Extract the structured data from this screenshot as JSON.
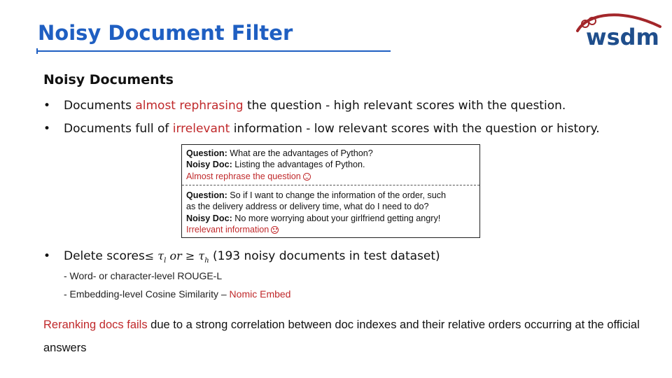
{
  "title": "Noisy Document Filter",
  "logo": {
    "text": "wsdm",
    "accent_color": "#a3262a",
    "text_color": "#1f4e8c"
  },
  "section_heading": "Noisy Documents",
  "bullets": [
    {
      "pre": "Documents ",
      "highlight": "almost rephrasing",
      "post": " the question - high relevant scores with the question."
    },
    {
      "pre": "Documents full of ",
      "highlight": "irrelevant",
      "post": " information - low relevant scores with the question or history."
    }
  ],
  "bullet_marker": "•",
  "figure": {
    "example1": {
      "question_label": "Question:",
      "question_text": " What are the advantages of Python?",
      "doc_label": "Noisy Doc:",
      "doc_text": " Listing the advantages of Python.",
      "note": "Almost rephrase the question"
    },
    "example2": {
      "question_label": "Question:",
      "question_text": " So if I want to change the information of the order, such",
      "question_text2": "as the delivery address or delivery time, what do I need to do?",
      "doc_label": "Noisy Doc:",
      "doc_text": " No more worrying about your girlfriend getting angry!",
      "note": "Irrelevant information"
    }
  },
  "delete_bullet": {
    "pre": "Delete scores",
    "leq": "≤",
    "tau_l": "τ",
    "l_sub": "l",
    "or": "or",
    "geq": "≥",
    "tau_h": "τ",
    "h_sub": "h",
    "post": "(193 noisy documents in test dataset)"
  },
  "sub_items": [
    {
      "text": "- Word- or character-level ROUGE-L",
      "highlight": ""
    },
    {
      "text": "- Embedding-level Cosine Similarity – ",
      "highlight": "Nomic Embed"
    }
  ],
  "footer": {
    "highlight": "Reranking docs fails",
    "rest": " due to a strong correlation between doc indexes and their relative orders occurring at the official answers"
  },
  "colors": {
    "title": "#1f5fc2",
    "highlight_red": "#c0292b"
  }
}
